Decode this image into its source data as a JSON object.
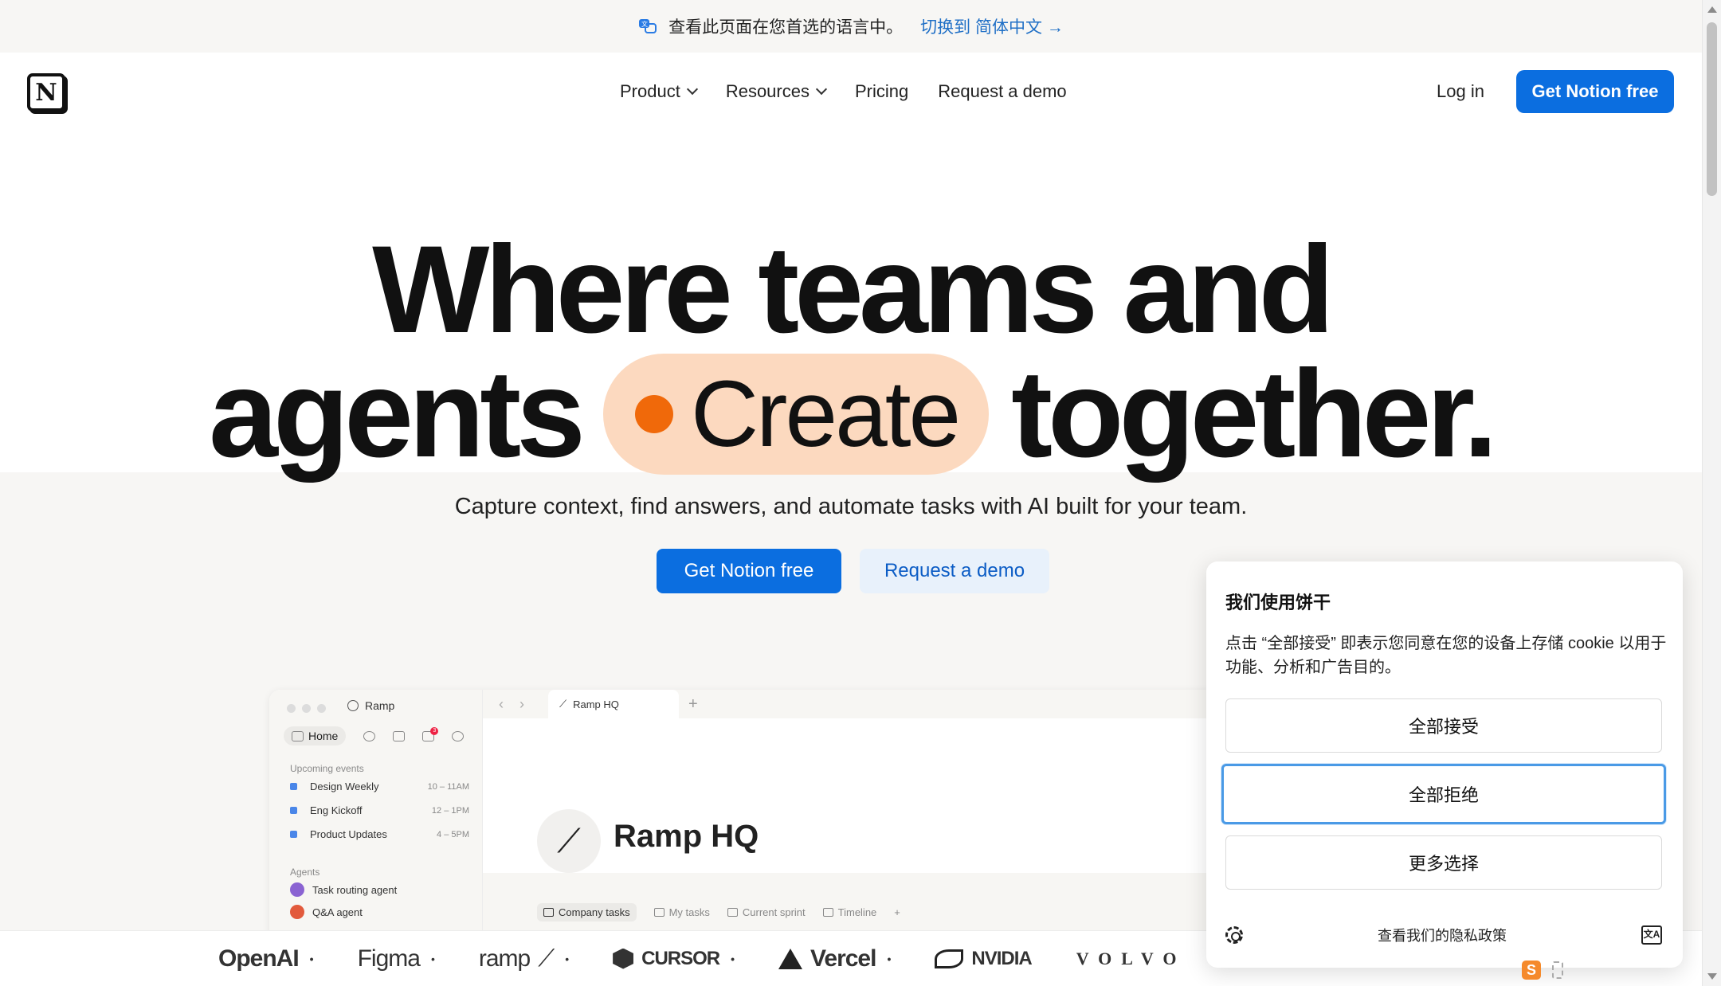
{
  "banner": {
    "message": "查看此页面在您首选的语言中。",
    "switch_link": "切换到 简体中文 →"
  },
  "nav": {
    "logo_letter": "N",
    "items": [
      {
        "label": "Product",
        "has_dropdown": true
      },
      {
        "label": "Resources",
        "has_dropdown": true
      },
      {
        "label": "Pricing",
        "has_dropdown": false
      },
      {
        "label": "Request a demo",
        "has_dropdown": false
      }
    ],
    "login": "Log in",
    "cta": "Get Notion free"
  },
  "hero": {
    "line1": "Where teams and",
    "line2_before": "agents",
    "pill_word": "Create",
    "line2_after": "together.",
    "subtitle": "Capture context, find answers, and automate tasks with AI built for your team.",
    "primary_button": "Get Notion free",
    "secondary_button": "Request a demo",
    "pill_color": "#fcd9bf",
    "dot_color": "#f0690a"
  },
  "app_preview": {
    "workspace": "Ramp",
    "home_label": "Home",
    "inbox_badge": "3",
    "upcoming_title": "Upcoming events",
    "events": [
      {
        "name": "Design Weekly",
        "time": "10 – 11AM"
      },
      {
        "name": "Eng Kickoff",
        "time": "12 – 1PM"
      },
      {
        "name": "Product Updates",
        "time": "4 – 5PM"
      }
    ],
    "agents_title": "Agents",
    "agents": [
      {
        "name": "Task routing agent",
        "color": "#8a63d2"
      },
      {
        "name": "Q&A agent",
        "color": "#e25a3c"
      }
    ],
    "tab_title": "Ramp HQ",
    "page_title": "Ramp HQ",
    "views": [
      "Company tasks",
      "My tasks",
      "Current sprint",
      "Timeline"
    ]
  },
  "logos": [
    {
      "name": "OpenAI"
    },
    {
      "name": "Figma"
    },
    {
      "name": "ramp"
    },
    {
      "name": "CURSOR"
    },
    {
      "name": "Vercel"
    },
    {
      "name": "NVIDIA"
    },
    {
      "name": "VOLVO"
    }
  ],
  "cookie": {
    "title": "我们使用饼干",
    "body": "点击 “全部接受” 即表示您同意在您的设备上存储 cookie 以用于功能、分析和广告目的。",
    "accept_all": "全部接受",
    "reject_all": "全部拒绝",
    "more_options": "更多选择",
    "privacy_link": "查看我们的隐私政策"
  },
  "colors": {
    "accent": "#0b6ee0",
    "banner_link": "#1f6fc6",
    "page_alt_bg": "#f7f6f4"
  }
}
